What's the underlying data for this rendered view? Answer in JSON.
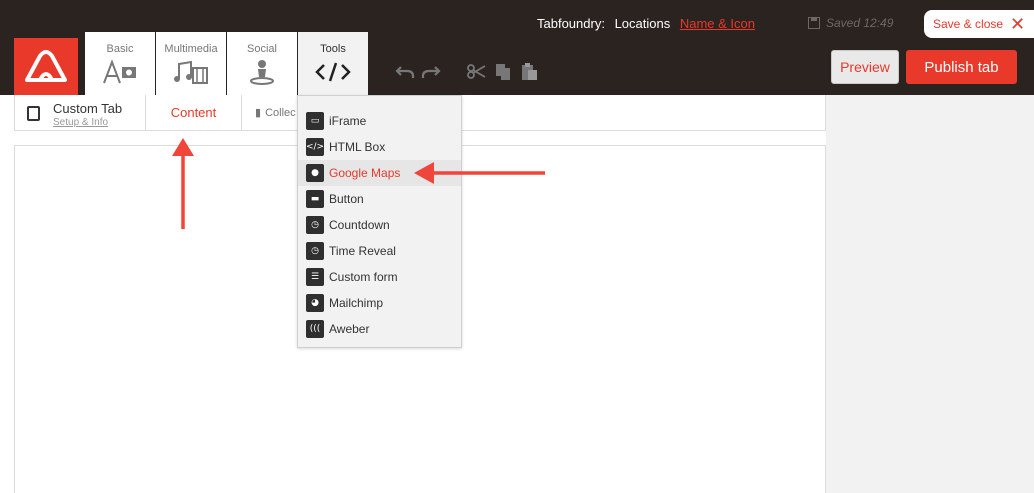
{
  "header": {
    "app_name": "Tabfoundry:",
    "section": "Locations",
    "link_label": "Name & Icon",
    "saved_text": "Saved 12:49",
    "save_close_label": "Save & close"
  },
  "toolbar": {
    "tabs": [
      {
        "label": "Basic",
        "icon": "text-image-icon"
      },
      {
        "label": "Multimedia",
        "icon": "music-film-icon"
      },
      {
        "label": "Social",
        "icon": "person-pin-icon"
      },
      {
        "label": "Tools",
        "icon": "code-icon",
        "active": true
      }
    ],
    "actions": [
      "undo-icon",
      "redo-icon",
      "cut-icon",
      "copy-icon",
      "paste-icon"
    ],
    "preview_label": "Preview",
    "publish_label": "Publish tab"
  },
  "subbar": {
    "page_title": "Custom Tab",
    "setup_link": "Setup & Info",
    "content_tab": "Content",
    "collection_tab": "Collec"
  },
  "tools_menu": {
    "items": [
      {
        "label": "iFrame",
        "icon": "iframe-icon"
      },
      {
        "label": "HTML Box",
        "icon": "html-box-icon"
      },
      {
        "label": "Google Maps",
        "icon": "map-pin-icon",
        "highlighted": true
      },
      {
        "label": "Button",
        "icon": "button-icon"
      },
      {
        "label": "Countdown",
        "icon": "countdown-icon"
      },
      {
        "label": "Time Reveal",
        "icon": "time-reveal-icon"
      },
      {
        "label": "Custom form",
        "icon": "form-icon"
      },
      {
        "label": "Mailchimp",
        "icon": "mailchimp-icon"
      },
      {
        "label": "Aweber",
        "icon": "aweber-icon"
      }
    ]
  },
  "colors": {
    "brand": "#e8392a",
    "topbar": "#2a2320",
    "panel": "#f2f2f2"
  }
}
